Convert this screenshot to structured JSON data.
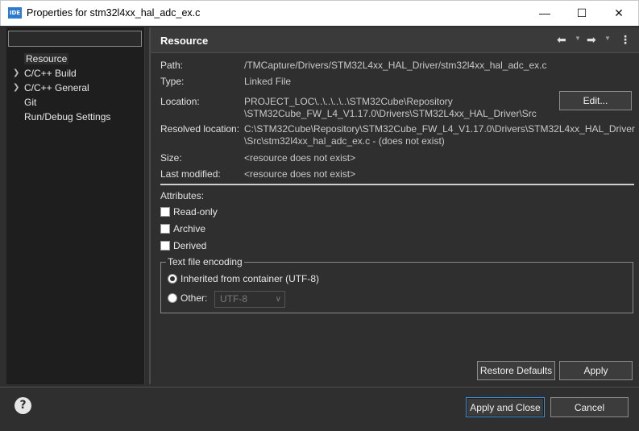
{
  "window": {
    "app_icon_text": "IDE",
    "title": "Properties for stm32l4xx_hal_adc_ex.c",
    "minimize": "—",
    "maximize": "☐",
    "close": "✕"
  },
  "sidebar": {
    "filter_value": "",
    "items": [
      {
        "label": "Resource",
        "expandable": false,
        "selected": true
      },
      {
        "label": "C/C++ Build",
        "expandable": true,
        "selected": false
      },
      {
        "label": "C/C++ General",
        "expandable": true,
        "selected": false
      },
      {
        "label": "Git",
        "expandable": false,
        "selected": false
      },
      {
        "label": "Run/Debug Settings",
        "expandable": false,
        "selected": false
      }
    ]
  },
  "header": {
    "title": "Resource",
    "back_icon": "arrow-left-icon",
    "forward_icon": "arrow-right-icon",
    "menu_icon": "vertical-ellipsis-icon"
  },
  "properties": {
    "path_label": "Path:",
    "path_value": "/TMCapture/Drivers/STM32L4xx_HAL_Driver/stm32l4xx_hal_adc_ex.c",
    "type_label": "Type:",
    "type_value": "Linked File",
    "location_label": "Location:",
    "location_value_1": "PROJECT_LOC\\..\\..\\..\\..\\STM32Cube\\Repository",
    "location_value_2": "\\STM32Cube_FW_L4_V1.17.0\\Drivers\\STM32L4xx_HAL_Driver\\Src",
    "edit_button": "Edit...",
    "resolved_label": "Resolved location:",
    "resolved_value_1": "C:\\STM32Cube\\Repository\\STM32Cube_FW_L4_V1.17.0\\Drivers\\STM32L4xx_HAL_Driver",
    "resolved_value_2": "\\Src\\stm32l4xx_hal_adc_ex.c - (does not exist)",
    "size_label": "Size:",
    "size_value": "<resource does not exist>",
    "modified_label": "Last modified:",
    "modified_value": "<resource does not exist>"
  },
  "attributes": {
    "label": "Attributes:",
    "read_only": {
      "label": "Read-only",
      "checked": false
    },
    "archive": {
      "label": "Archive",
      "checked": false
    },
    "derived": {
      "label": "Derived",
      "checked": false
    }
  },
  "encoding": {
    "legend": "Text file encoding",
    "inherited_label": "Inherited from container (UTF-8)",
    "other_label": "Other:",
    "other_select_value": "UTF-8",
    "selected": "inherited"
  },
  "buttons": {
    "restore_defaults": "Restore Defaults",
    "apply": "Apply",
    "apply_and_close": "Apply and Close",
    "cancel": "Cancel",
    "help": "?"
  }
}
